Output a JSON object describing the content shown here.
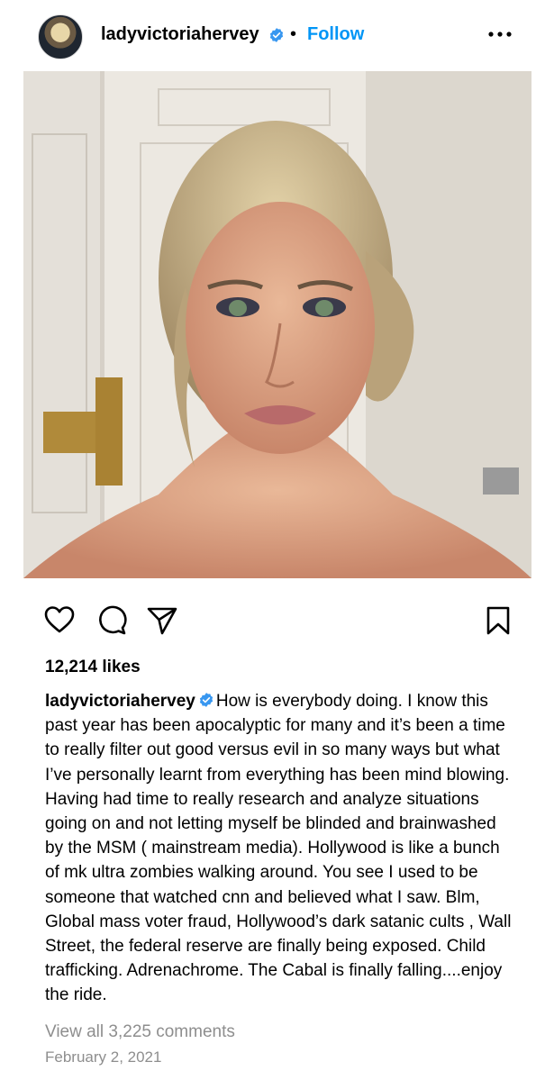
{
  "post": {
    "username": "ladyvictoriahervey",
    "separator": "•",
    "follow_label": "Follow",
    "more_icon": "more-horizontal-icon",
    "verified_icon": "verified-badge-icon",
    "photo_alt": "Portrait photo",
    "likes": "12,214 likes",
    "caption_user": "ladyvictoriahervey",
    "caption_text": "How is everybody doing. I know this past year has been apocalyptic for many and it’s been a time to really filter out good versus evil in so many ways but what I’ve personally learnt from everything has been mind blowing. Having had time to really research and analyze situations going on and not letting myself be blinded and brainwashed by the MSM ( mainstream media). Hollywood is like a bunch of mk ultra zombies walking around. You see I used to be someone that watched cnn and believed what I saw. Blm, Global mass voter fraud, Hollywood’s dark satanic cults , Wall Street, the federal reserve are finally being exposed. Child trafficking. Adrenachrome. The Cabal is finally falling....enjoy the ride.",
    "view_comments": "View all 3,225 comments",
    "date": "February 2, 2021"
  },
  "icons": {
    "like": "heart-icon",
    "comment": "comment-icon",
    "share": "send-icon",
    "save": "bookmark-icon"
  },
  "colors": {
    "link_blue": "#0095f6",
    "muted_gray": "#8e8e8e",
    "verified_blue": "#3897f0"
  }
}
